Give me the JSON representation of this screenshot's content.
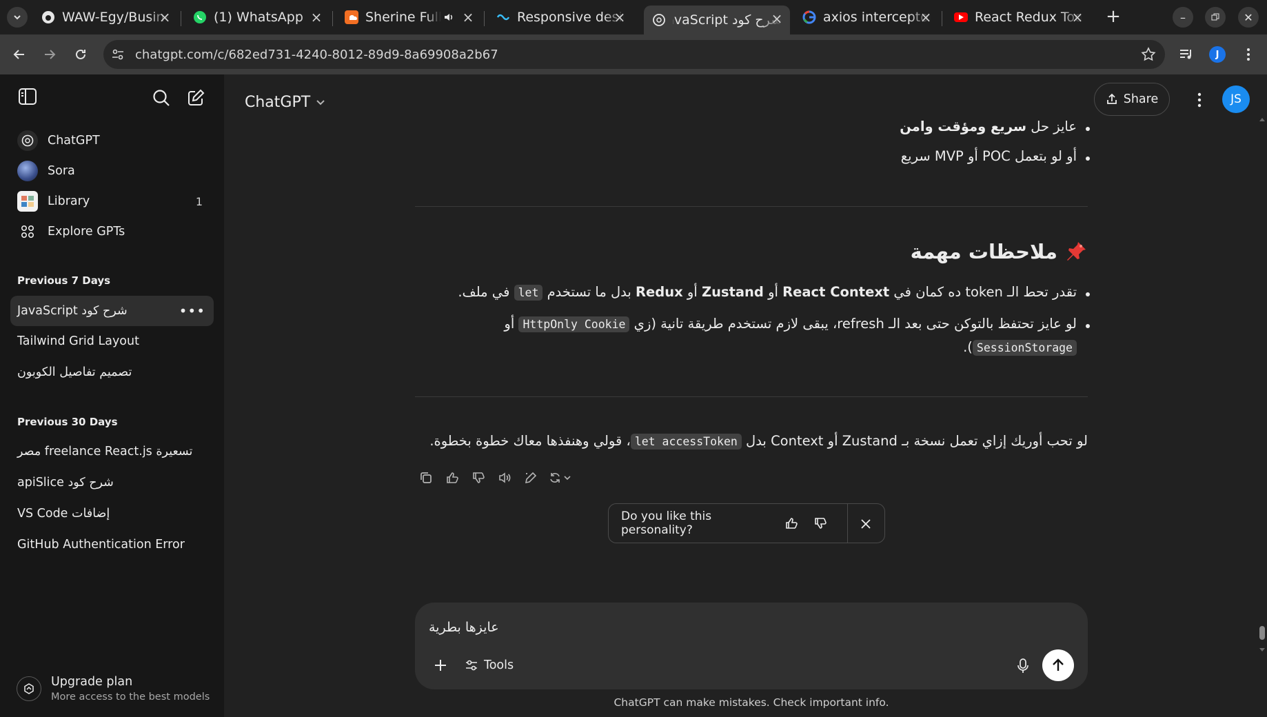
{
  "browser": {
    "tabs": [
      {
        "title": "WAW-Egy/Business",
        "favicon": "github-icon"
      },
      {
        "title": "(1) WhatsApp",
        "favicon": "whatsapp-icon"
      },
      {
        "title": "Sherine Full Album",
        "favicon": "soundcloud-icon"
      },
      {
        "title": "Responsive design",
        "favicon": "tailwind-icon"
      },
      {
        "title": "شرح كود JavaScript",
        "favicon": "chatgpt-icon",
        "active": true
      },
      {
        "title": "axios interceptors",
        "favicon": "google-icon"
      },
      {
        "title": "React Redux Toolkit",
        "favicon": "youtube-icon"
      }
    ],
    "url": "chatgpt.com/c/682ed731-4240-8012-89d9-8a69908a2b67",
    "profile_initial": "J"
  },
  "sidebar": {
    "nav": [
      {
        "label": "ChatGPT",
        "icon": "chatgpt-icon"
      },
      {
        "label": "Sora",
        "icon": "sora-icon"
      },
      {
        "label": "Library",
        "icon": "library-icon",
        "badge": "1"
      },
      {
        "label": "Explore GPTs",
        "icon": "explore-grid-icon"
      }
    ],
    "sections": [
      {
        "title": "Previous 7 Days",
        "items": [
          "شرح كود JavaScript",
          "Tailwind Grid Layout",
          "تصميم تفاصيل الكوبون"
        ]
      },
      {
        "title": "Previous 30 Days",
        "items": [
          "تسعيرة freelance React.js مصر",
          "شرح كود apiSlice",
          "إضافات VS Code",
          "GitHub Authentication Error"
        ]
      }
    ],
    "upgrade": {
      "title": "Upgrade plan",
      "subtitle": "More access to the best models"
    }
  },
  "header": {
    "model": "ChatGPT",
    "share_label": "Share",
    "avatar_initials": "JS"
  },
  "message": {
    "bullets_top": [
      {
        "pre": "عايز حل ",
        "bold": "سريع ومؤقت وامن",
        "post": ""
      },
      {
        "pre": "أو لو بتعمل POC أو MVP سريع",
        "bold": "",
        "post": ""
      }
    ],
    "heading": "ملاحظات مهمة",
    "note1": {
      "a": "تقدر تحط الـ token ده كمان في ",
      "b": "React Context",
      "c": " أو ",
      "d": "Zustand",
      "e": " أو ",
      "f": "Redux",
      "g": " بدل ما تستخدم ",
      "code": "let",
      "h": " في ملف."
    },
    "note2_line1": {
      "a": "لو عايز تحتفظ بالتوكن حتى بعد الـ refresh، يبقى لازم تستخدم طريقة تانية (زي ",
      "code": "HttpOnly Cookie",
      "b": " أو"
    },
    "note2_line2": {
      "code": "SessionStorage",
      "b": ")."
    },
    "closing": {
      "a": "لو تحب أوريك إزاي تعمل نسخة بـ Zustand أو Context بدل ",
      "code": "let accessToken",
      "b": "، قولي وهنفذها معاك خطوة بخطوة."
    }
  },
  "feedback": {
    "question": "Do you like this personality?"
  },
  "composer": {
    "value": "عايزها بطرية",
    "tools_label": "Tools"
  },
  "disclaimer": "ChatGPT can make mistakes. Check important info."
}
